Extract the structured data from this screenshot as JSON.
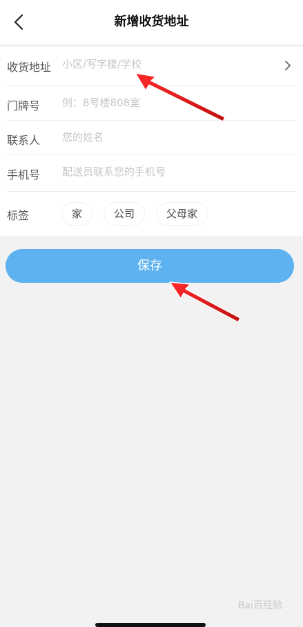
{
  "header": {
    "title": "新增收货地址",
    "back_icon": "chevron-left-icon"
  },
  "form": {
    "address": {
      "label": "收货地址",
      "placeholder": "小区/写字楼/学校"
    },
    "door": {
      "label": "门牌号",
      "placeholder": "例：8号楼808室"
    },
    "contact": {
      "label": "联系人",
      "placeholder": "您的姓名"
    },
    "phone": {
      "label": "手机号",
      "placeholder": "配送员联系您的手机号"
    },
    "tags": {
      "label": "标签",
      "options": [
        "家",
        "公司",
        "父母家"
      ]
    }
  },
  "save_button": {
    "label": "保存",
    "color": "#5db2ef"
  },
  "watermark": {
    "text": "Bai百经验"
  },
  "colors": {
    "background": "#f2f2f2",
    "annotation_arrow": "#e02020"
  }
}
